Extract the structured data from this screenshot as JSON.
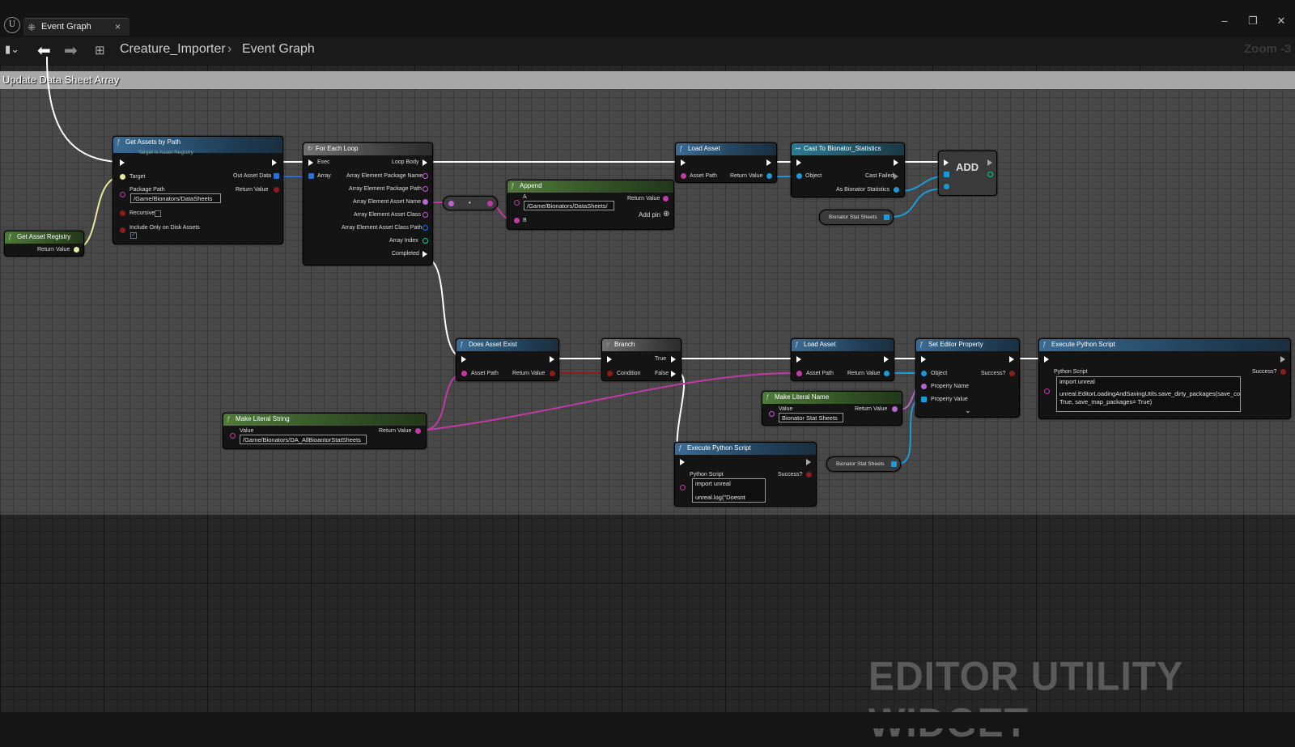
{
  "window": {
    "tab_label": "Event Graph",
    "close": "×",
    "minimize": "–",
    "restore": "❐",
    "close_window": "✕"
  },
  "toolbar": {
    "breadcrumb_asset": "Creature_Importer",
    "breadcrumb_sep": "›",
    "breadcrumb_graph": "Event Graph",
    "zoom": "Zoom -3"
  },
  "comment": {
    "title": "Update Data Sheet Array"
  },
  "watermark": "EDITOR UTILITY WIDGET",
  "nodes": {
    "get_asset_registry": {
      "title": "Get Asset Registry",
      "return": "Return Value"
    },
    "get_assets_by_path": {
      "title": "Get Assets by Path",
      "subtitle": "Target is Asset Registry",
      "target": "Target",
      "package_path": "Package Path",
      "package_path_value": "/Game/Bionators/DataSheets",
      "recursive": "Recursive",
      "include_disk": "Include Only on Disk Assets",
      "out": "Out Asset Data",
      "return": "Return Value"
    },
    "for_each": {
      "title": "For Each Loop",
      "exec": "Exec",
      "array": "Array",
      "loop_body": "Loop Body",
      "pkg_name": "Array Element Package Name",
      "pkg_path": "Array Element Package Path",
      "asset_name": "Array Element Asset Name",
      "asset_class": "Array Element Asset Class",
      "class_path": "Array Element Asset Class Path",
      "index": "Array Index",
      "completed": "Completed"
    },
    "append": {
      "title": "Append",
      "a": "A",
      "a_value": "/Game/Bionators/DataSheets/",
      "b": "B",
      "return": "Return Value",
      "add_pin": "Add pin"
    },
    "load_asset_1": {
      "title": "Load Asset",
      "asset_path": "Asset Path",
      "return": "Return Value"
    },
    "cast": {
      "title": "Cast To Bionator_Statistics",
      "object": "Object",
      "cast_failed": "Cast Failed",
      "as": "As Bionator Statistics"
    },
    "add": {
      "label": "ADD"
    },
    "var_stat_1": {
      "label": "Bionator Stat Sheets"
    },
    "does_exist": {
      "title": "Does Asset Exist",
      "asset_path": "Asset Path",
      "return": "Return Value"
    },
    "branch": {
      "title": "Branch",
      "condition": "Condition",
      "true": "True",
      "false": "False"
    },
    "load_asset_2": {
      "title": "Load Asset",
      "asset_path": "Asset Path",
      "return": "Return Value"
    },
    "set_prop": {
      "title": "Set Editor Property",
      "object": "Object",
      "prop_name": "Property Name",
      "prop_value": "Property Value",
      "success": "Success?"
    },
    "exec_py_1": {
      "title": "Execute Python Script",
      "label": "Python Script",
      "success": "Success?",
      "script_line1": "import unreal",
      "script_line2": "unreal.EditorLoadingAndSavingUtils.save_dirty_packages(save_co",
      "script_line3": "True, save_map_packages= True)"
    },
    "make_name": {
      "title": "Make Literal Name",
      "value": "Value",
      "value_text": "Bionator Stat Sheets",
      "return": "Return Value"
    },
    "make_string": {
      "title": "Make Literal String",
      "value": "Value",
      "value_text": "/Game/Bionators/DA_AllBioantorStatSheets",
      "return": "Return Value"
    },
    "exec_py_2": {
      "title": "Execute Python Script",
      "label": "Python Script",
      "success": "Success?",
      "script_line1": "import unreal",
      "script_line2": "unreal.log(\"Doesnt exist\")"
    },
    "var_stat_2": {
      "label": "Bionator Stat Sheets"
    }
  }
}
